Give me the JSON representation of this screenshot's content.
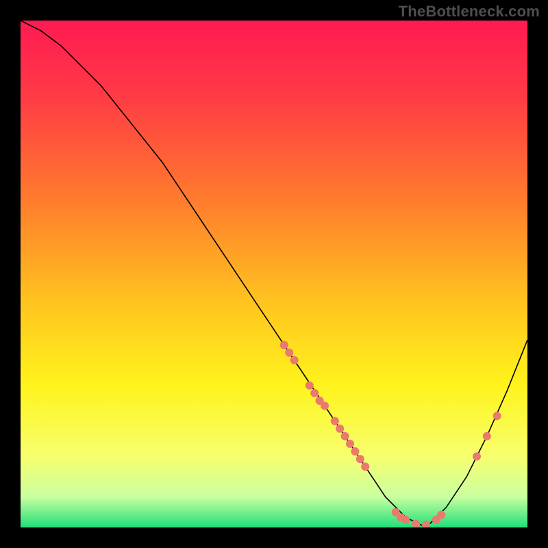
{
  "attribution": "TheBottleneck.com",
  "chart_data": {
    "type": "line",
    "title": "",
    "xlabel": "",
    "ylabel": "",
    "xlim": [
      0,
      100
    ],
    "ylim": [
      0,
      100
    ],
    "bg_gradient": {
      "stops": [
        {
          "offset": 0.0,
          "color": "#ff1a52"
        },
        {
          "offset": 0.15,
          "color": "#ff3b45"
        },
        {
          "offset": 0.35,
          "color": "#ff7a2d"
        },
        {
          "offset": 0.55,
          "color": "#ffc21f"
        },
        {
          "offset": 0.72,
          "color": "#fff41c"
        },
        {
          "offset": 0.86,
          "color": "#f7ff6e"
        },
        {
          "offset": 0.94,
          "color": "#c9ffa0"
        },
        {
          "offset": 1.0,
          "color": "#1fe07a"
        }
      ]
    },
    "series": [
      {
        "name": "bottleneck-curve",
        "color": "#000000",
        "width": 1.6,
        "x": [
          0,
          4,
          8,
          12,
          16,
          20,
          24,
          28,
          32,
          36,
          40,
          44,
          48,
          52,
          56,
          60,
          64,
          68,
          72,
          76,
          80,
          84,
          88,
          92,
          96,
          100
        ],
        "y": [
          100,
          98,
          95,
          91,
          87,
          82,
          77,
          72,
          66,
          60,
          54,
          48,
          42,
          36,
          30,
          24,
          18,
          12,
          6,
          2,
          0,
          4,
          10,
          18,
          27,
          37
        ]
      }
    ],
    "markers": {
      "name": "highlight-points",
      "color": "#e97a6d",
      "radius": 6,
      "points": [
        {
          "x": 52,
          "y": 36
        },
        {
          "x": 53,
          "y": 34.5
        },
        {
          "x": 54,
          "y": 33
        },
        {
          "x": 57,
          "y": 28
        },
        {
          "x": 58,
          "y": 26.5
        },
        {
          "x": 59,
          "y": 25
        },
        {
          "x": 60,
          "y": 24
        },
        {
          "x": 62,
          "y": 21
        },
        {
          "x": 63,
          "y": 19.5
        },
        {
          "x": 64,
          "y": 18
        },
        {
          "x": 65,
          "y": 16.5
        },
        {
          "x": 66,
          "y": 15
        },
        {
          "x": 67,
          "y": 13.5
        },
        {
          "x": 68,
          "y": 12
        },
        {
          "x": 74,
          "y": 3.0
        },
        {
          "x": 75,
          "y": 2.0
        },
        {
          "x": 76,
          "y": 1.5
        },
        {
          "x": 78,
          "y": 0.7
        },
        {
          "x": 80,
          "y": 0.5
        },
        {
          "x": 82,
          "y": 1.5
        },
        {
          "x": 83,
          "y": 2.5
        },
        {
          "x": 90,
          "y": 14
        },
        {
          "x": 92,
          "y": 18
        },
        {
          "x": 94,
          "y": 22
        }
      ]
    }
  }
}
